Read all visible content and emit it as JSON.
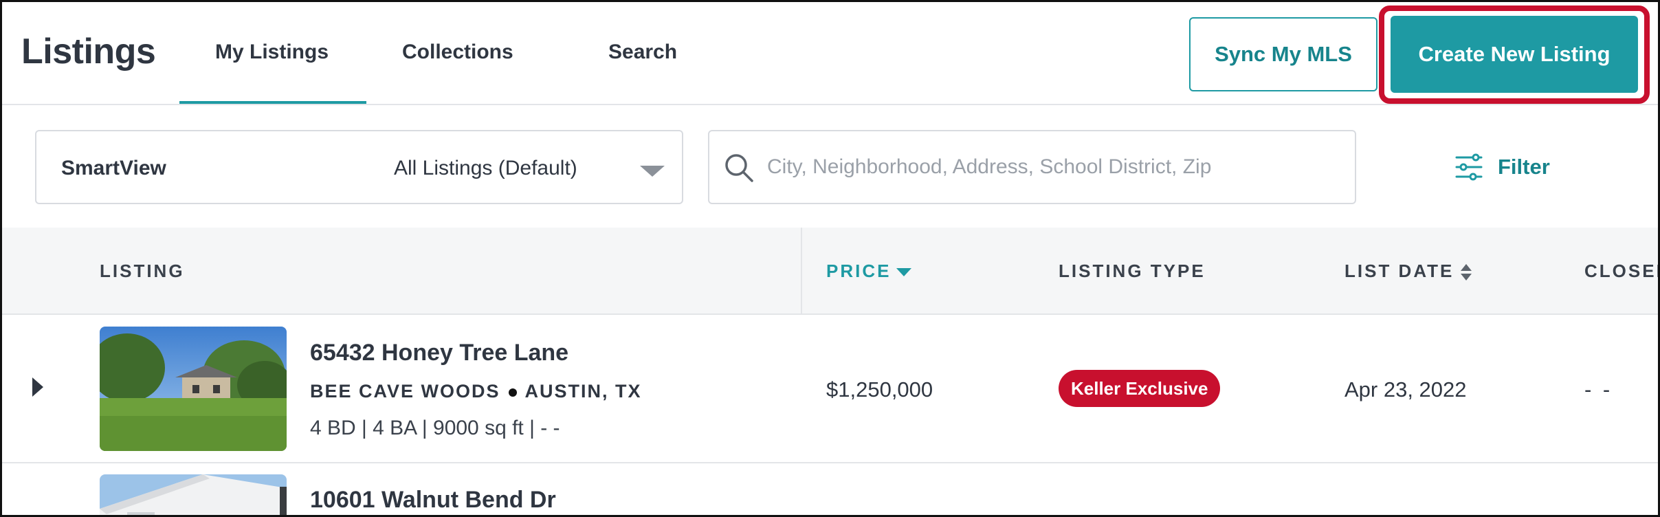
{
  "header": {
    "title": "Listings",
    "tabs": [
      {
        "label": "My Listings",
        "active": true
      },
      {
        "label": "Collections",
        "active": false
      },
      {
        "label": "Search",
        "active": false
      }
    ],
    "sync_label": "Sync My MLS",
    "create_label": "Create New Listing"
  },
  "toolbar": {
    "smartview_label": "SmartView",
    "smartview_value": "All Listings (Default)",
    "search_placeholder": "City, Neighborhood, Address, School District, Zip",
    "filter_label": "Filter"
  },
  "table": {
    "columns": {
      "listing": "LISTING",
      "price": "PRICE",
      "type": "LISTING TYPE",
      "date": "LIST DATE",
      "closed": "CLOSED"
    },
    "rows": [
      {
        "address": "65432 Honey Tree Lane",
        "neighborhood": "BEE CAVE WOODS",
        "city": "AUSTIN, TX",
        "specs": "4 BD | 4 BA | 9000 sq ft | - -",
        "price": "$1,250,000",
        "type": "Keller Exclusive",
        "list_date": "Apr 23, 2022",
        "closed": "- -"
      },
      {
        "address": "10601 Walnut Bend Dr"
      }
    ]
  },
  "colors": {
    "accent": "#1e9aa3",
    "highlight_ring": "#c8102e",
    "badge": "#c8102e",
    "text": "#2f3641"
  },
  "icons": [
    "search-icon",
    "filter-sliders-icon",
    "chevron-down-icon",
    "sort-icon",
    "expand-arrow-icon"
  ]
}
